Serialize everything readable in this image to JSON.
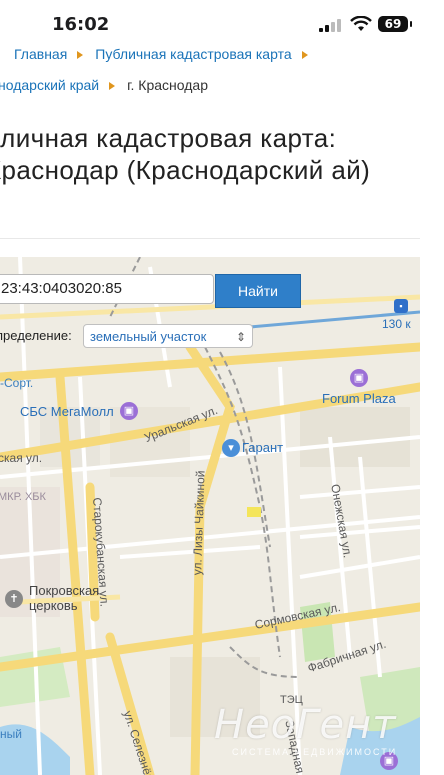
{
  "status_bar": {
    "time": "16:02",
    "battery": "69"
  },
  "breadcrumbs": {
    "row1": [
      "Главная",
      "Публичная кадастровая карта"
    ],
    "row2": [
      "нодарский край",
      "г. Краснодар"
    ]
  },
  "page_title": "бличная кадастровая карта: Краснодар (Краснодарский ай)",
  "map": {
    "search": {
      "value": "23:43:0403020:85",
      "button_label": "Найти"
    },
    "definition": {
      "label": "пределение:",
      "selected": "земельный участок"
    },
    "streets": [
      "Уральская ул.",
      "ская ул.",
      "Старокубанская ул.",
      "ул. Лизы Чайкиной",
      "Онежская ул.",
      "Сормовская ул.",
      "Фабричная ул.",
      "ул. Селезнёва",
      "Западная ул."
    ],
    "places": [
      {
        "name": "Forum Plaza",
        "icon": "shopping-bag-icon"
      },
      {
        "name": "СБС МегаМолл",
        "icon": "shopping-bag-icon"
      },
      {
        "name": "Гарант",
        "icon": "shopping-basket-icon"
      },
      {
        "name": "Покровская церковь",
        "icon": "church-icon"
      },
      {
        "name": "130 к",
        "icon": "bus-stop-icon"
      }
    ],
    "areas": [
      "-Сорт.",
      "МКР. ХБК",
      "ТЭЦ",
      "ный"
    ],
    "watermark": {
      "brand": "НеоГент",
      "subtitle": "СИСТЕМА НЕДВИЖИМОСТИ"
    },
    "colors": {
      "road_main": "#f6d97a",
      "road_minor": "#ffffff",
      "green": "#c9e6b3",
      "water": "#a9d3ee",
      "rail": "#9a9a9a"
    }
  }
}
